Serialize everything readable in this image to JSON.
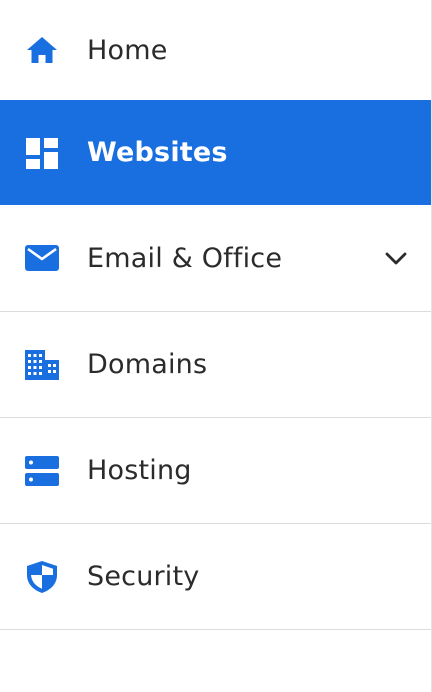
{
  "nav": {
    "items": [
      {
        "label": "Home",
        "icon": "home-icon",
        "active": false
      },
      {
        "label": "Websites",
        "icon": "websites-grid-icon",
        "active": true
      },
      {
        "label": "Email & Office",
        "icon": "envelope-icon",
        "active": false,
        "expandable": true
      },
      {
        "label": "Domains",
        "icon": "building-icon",
        "active": false
      },
      {
        "label": "Hosting",
        "icon": "server-icon",
        "active": false
      },
      {
        "label": "Security",
        "icon": "shield-icon",
        "active": false
      }
    ]
  },
  "colors": {
    "accent": "#1a6fe0",
    "icon": "#1a6fe0",
    "text": "#2b2b2b",
    "active_text": "#ffffff",
    "divider": "#dcdcdc"
  }
}
